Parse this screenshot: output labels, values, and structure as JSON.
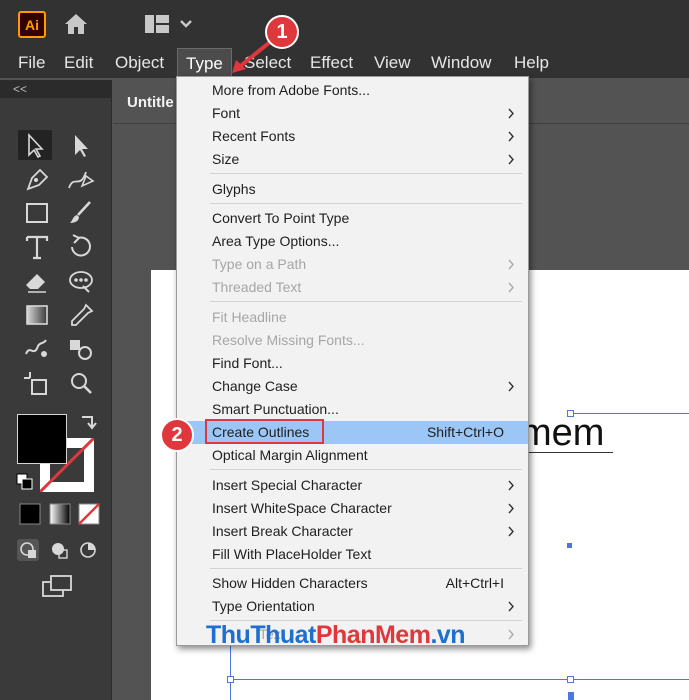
{
  "app": {
    "logo_text": "Ai"
  },
  "menubar": {
    "items": [
      "File",
      "Edit",
      "Object",
      "Type",
      "Select",
      "Effect",
      "View",
      "Window",
      "Help"
    ],
    "active": "Type"
  },
  "panel": {
    "collapse_glyph": "<<"
  },
  "document": {
    "tab_title": "Untitle",
    "canvas_text": "mem"
  },
  "type_menu": {
    "items": [
      {
        "label": "More from Adobe Fonts...",
        "submenu": false,
        "disabled": false
      },
      {
        "label": "Font",
        "submenu": true,
        "disabled": false
      },
      {
        "label": "Recent Fonts",
        "submenu": true,
        "disabled": false
      },
      {
        "label": "Size",
        "submenu": true,
        "disabled": false
      },
      {
        "label": "Glyphs",
        "submenu": false,
        "disabled": false
      },
      {
        "label": "Convert To Point Type",
        "submenu": false,
        "disabled": false
      },
      {
        "label": "Area Type Options...",
        "submenu": false,
        "disabled": false
      },
      {
        "label": "Type on a Path",
        "submenu": true,
        "disabled": true
      },
      {
        "label": "Threaded Text",
        "submenu": true,
        "disabled": true
      },
      {
        "label": "Fit Headline",
        "submenu": false,
        "disabled": true
      },
      {
        "label": "Resolve Missing Fonts...",
        "submenu": false,
        "disabled": true
      },
      {
        "label": "Find Font...",
        "submenu": false,
        "disabled": false
      },
      {
        "label": "Change Case",
        "submenu": true,
        "disabled": false
      },
      {
        "label": "Smart Punctuation...",
        "submenu": false,
        "disabled": false
      },
      {
        "label": "Create Outlines",
        "submenu": false,
        "disabled": false,
        "shortcut": "Shift+Ctrl+O",
        "highlighted": true
      },
      {
        "label": "Optical Margin Alignment",
        "submenu": false,
        "disabled": false
      },
      {
        "label": "Insert Special Character",
        "submenu": true,
        "disabled": false
      },
      {
        "label": "Insert WhiteSpace Character",
        "submenu": true,
        "disabled": false
      },
      {
        "label": "Insert Break Character",
        "submenu": true,
        "disabled": false
      },
      {
        "label": "Fill With PlaceHolder Text",
        "submenu": false,
        "disabled": false
      },
      {
        "label": "Show Hidden Characters",
        "submenu": false,
        "disabled": false,
        "shortcut": "Alt+Ctrl+I"
      },
      {
        "label": "Type Orientation",
        "submenu": true,
        "disabled": false
      },
      {
        "label": "Text",
        "submenu": true,
        "disabled": true
      }
    ]
  },
  "annotations": {
    "step1": "1",
    "step2": "2"
  },
  "watermark": {
    "part1": "ThuThuat",
    "part2": "PhanMem",
    "part3": ".vn"
  },
  "colors": {
    "accent_red": "#e0373c",
    "highlight": "#9cc6f5",
    "selection_blue": "#4a78e0",
    "logo_orange": "#ff9a00"
  }
}
